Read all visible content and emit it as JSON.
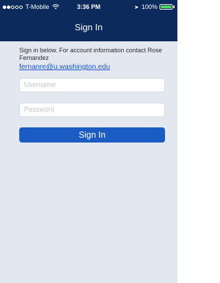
{
  "status_bar": {
    "carrier": "T-Mobile",
    "time": "3:36 PM",
    "battery": "100%",
    "battery_level": 1.0,
    "signal_bars_filled": 2,
    "signal_bars_total": 5,
    "icons": [
      "wifi-icon",
      "location-arrow-icon",
      "battery-icon"
    ]
  },
  "nav": {
    "title": "Sign In"
  },
  "info": {
    "text": "Sign in below. For account information contact Rose Fernandez",
    "email": "fernanre@u.washington.edu"
  },
  "form": {
    "username_placeholder": "Username",
    "password_placeholder": "Password",
    "submit_label": "Sign In"
  },
  "colors": {
    "header": "#0c2b5c",
    "button": "#1a5bc4",
    "background": "#e3e7f0",
    "link": "#1a55cc"
  }
}
